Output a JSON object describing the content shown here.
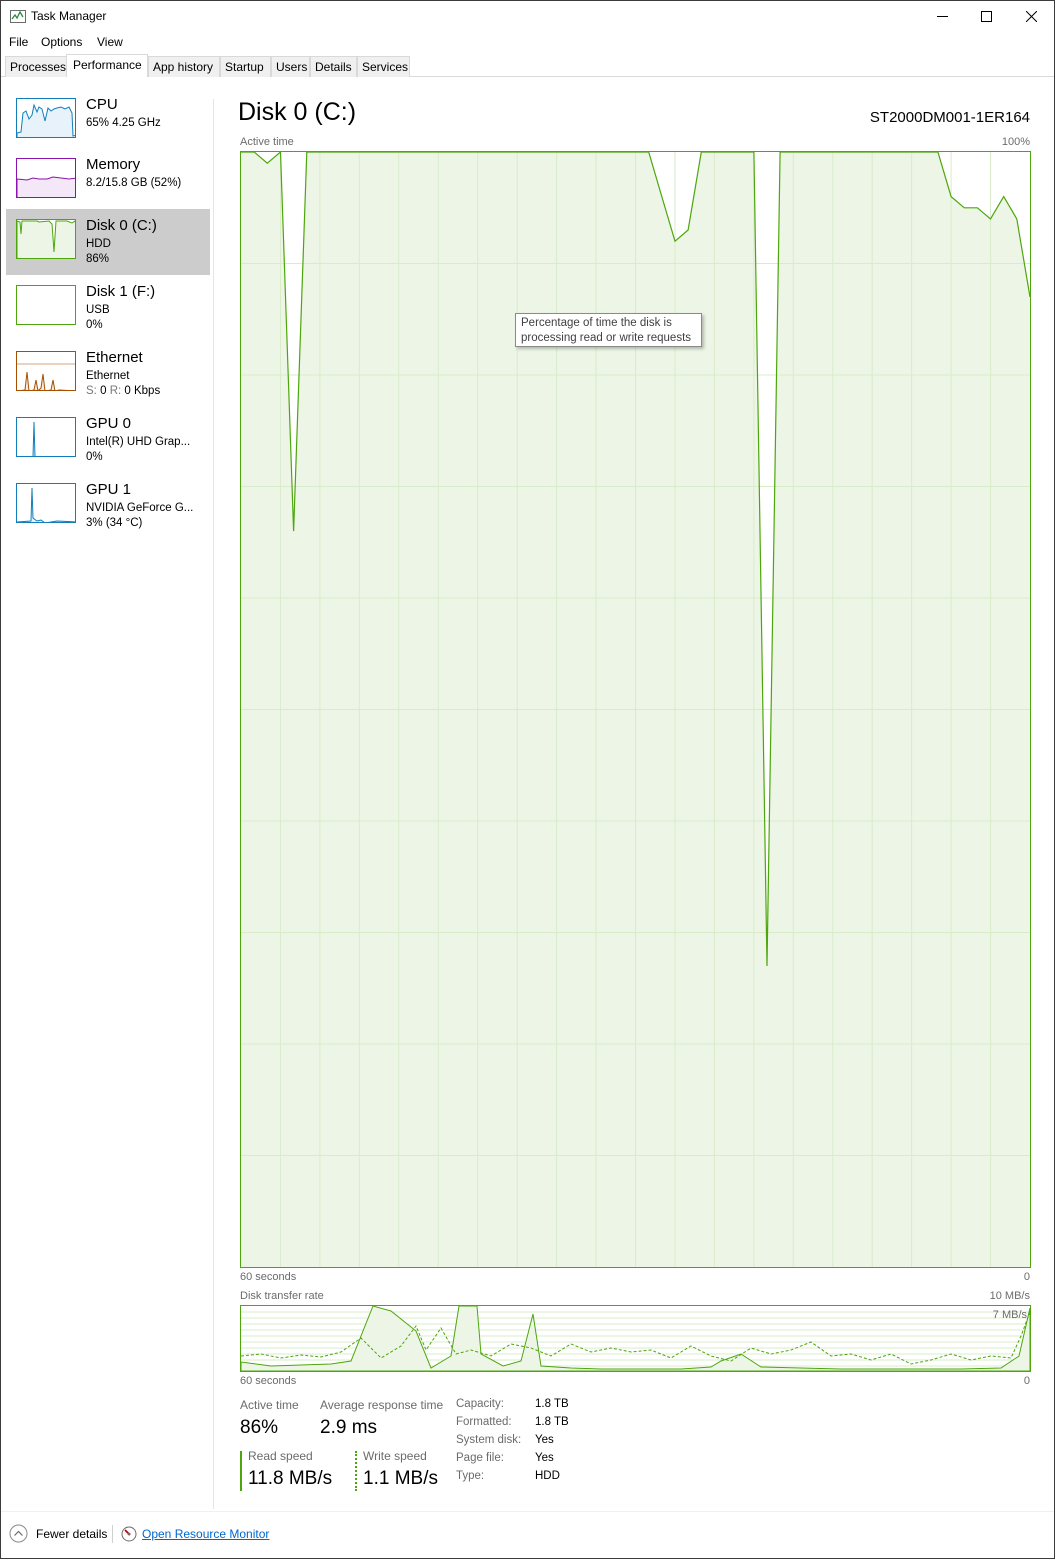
{
  "window": {
    "title": "Task Manager"
  },
  "menu": [
    "File",
    "Options",
    "View"
  ],
  "tabs": [
    "Processes",
    "Performance",
    "App history",
    "Startup",
    "Users",
    "Details",
    "Services"
  ],
  "sidebar": {
    "items": [
      {
        "name": "CPU",
        "line2": "65% 4.25 GHz",
        "line3": ""
      },
      {
        "name": "Memory",
        "line2": "8.2/15.8 GB (52%)",
        "line3": ""
      },
      {
        "name": "Disk 0 (C:)",
        "line2": "HDD",
        "line3": "86%"
      },
      {
        "name": "Disk 1 (F:)",
        "line2": "USB",
        "line3": "0%"
      },
      {
        "name": "Ethernet",
        "line2": "Ethernet",
        "line3_s": "S:",
        "line3_sv": "0",
        "line3_r": "R:",
        "line3_rv": "0 Kbps"
      },
      {
        "name": "GPU 0",
        "line2": "Intel(R) UHD Grap...",
        "line3": "0%"
      },
      {
        "name": "GPU 1",
        "line2": "NVIDIA GeForce G...",
        "line3": "3% (34 °C)"
      }
    ],
    "colors": {
      "cpu": "#117dbb",
      "memory": "#8b12ae",
      "disk": "#4da60c",
      "ethernet": "#a74f01",
      "gpu": "#117dbb"
    }
  },
  "main": {
    "title": "Disk 0 (C:)",
    "model": "ST2000DM001-1ER164",
    "active_graph": {
      "label": "Active time",
      "max": "100%",
      "time": "60 seconds",
      "min": "0"
    },
    "tooltip": {
      "line1": "Percentage of time the disk is",
      "line2": "processing read or write requests"
    },
    "transfer_graph": {
      "label": "Disk transfer rate",
      "max": "10 MB/s",
      "inner": "7 MB/s",
      "time": "60 seconds",
      "min": "0"
    },
    "stats": {
      "active_label": "Active time",
      "active_value": "86%",
      "response_label": "Average response time",
      "response_value": "2.9 ms",
      "read_label": "Read speed",
      "read_value": "11.8 MB/s",
      "write_label": "Write speed",
      "write_value": "1.1 MB/s"
    },
    "props": [
      {
        "label": "Capacity:",
        "value": "1.8 TB"
      },
      {
        "label": "Formatted:",
        "value": "1.8 TB"
      },
      {
        "label": "System disk:",
        "value": "Yes"
      },
      {
        "label": "Page file:",
        "value": "Yes"
      },
      {
        "label": "Type:",
        "value": "HDD"
      }
    ]
  },
  "footer": {
    "fewer": "Fewer details",
    "monitor": "Open Resource Monitor"
  },
  "chart_data": {
    "type": "area",
    "title": "Active time",
    "ylim": [
      0,
      100
    ],
    "x": [
      60,
      59,
      58,
      57,
      56,
      55,
      54,
      53,
      52,
      51,
      50,
      49,
      48,
      47,
      46,
      45,
      44,
      43,
      42,
      41,
      40,
      39,
      38,
      37,
      36,
      35,
      34,
      33,
      32,
      31,
      30,
      29,
      28,
      27,
      26,
      25,
      24,
      23,
      22,
      21,
      20,
      19,
      18,
      17,
      16,
      15,
      14,
      13,
      12,
      11,
      10,
      9,
      8,
      7,
      6,
      5,
      4,
      3,
      2,
      1,
      0
    ],
    "series": [
      {
        "values": [
          100,
          100,
          99,
          100,
          66,
          100,
          100,
          100,
          100,
          100,
          100,
          100,
          100,
          100,
          100,
          100,
          100,
          100,
          100,
          100,
          100,
          100,
          100,
          100,
          100,
          100,
          100,
          100,
          100,
          100,
          100,
          100,
          96,
          92,
          93,
          100,
          100,
          100,
          100,
          100,
          27,
          100,
          100,
          100,
          100,
          100,
          100,
          100,
          100,
          100,
          100,
          100,
          100,
          100,
          96,
          95,
          95,
          94,
          96,
          94,
          87
        ]
      }
    ]
  }
}
